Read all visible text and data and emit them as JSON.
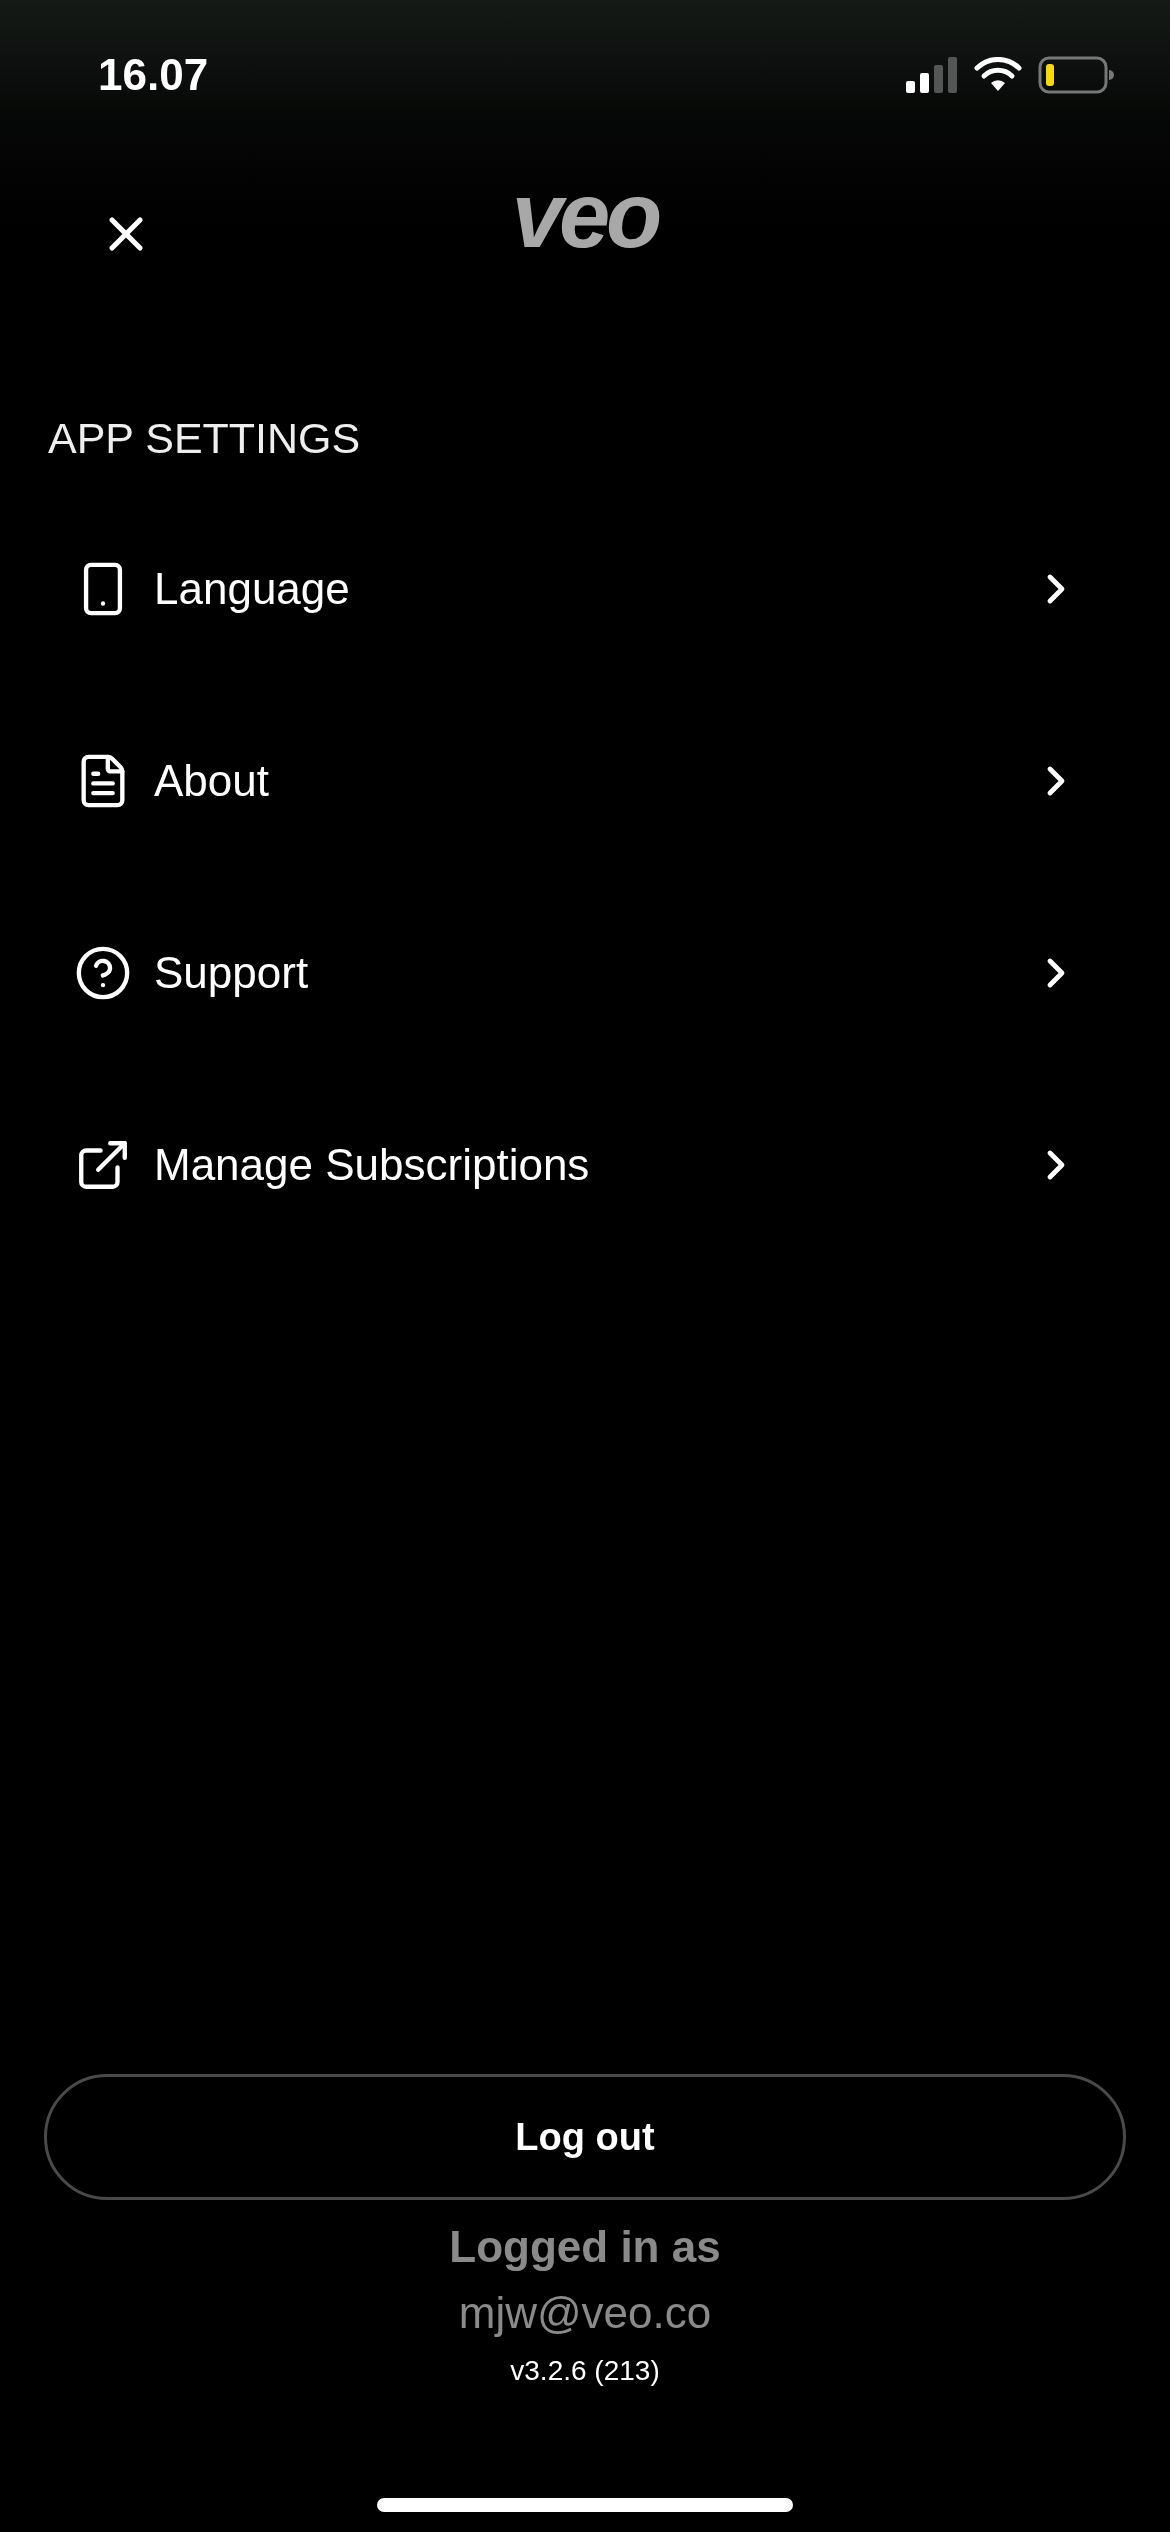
{
  "status_bar": {
    "time": "16.07"
  },
  "header": {
    "logo": "veo"
  },
  "section": {
    "title": "APP SETTINGS"
  },
  "items": [
    {
      "kind": "phone",
      "label": "Language"
    },
    {
      "kind": "document",
      "label": "About"
    },
    {
      "kind": "help",
      "label": "Support"
    },
    {
      "kind": "external",
      "label": "Manage Subscriptions"
    }
  ],
  "logout_button": "Log out",
  "account": {
    "caption": "Logged in as",
    "email": "mjw@veo.co",
    "version": "v3.2.6 (213)"
  }
}
